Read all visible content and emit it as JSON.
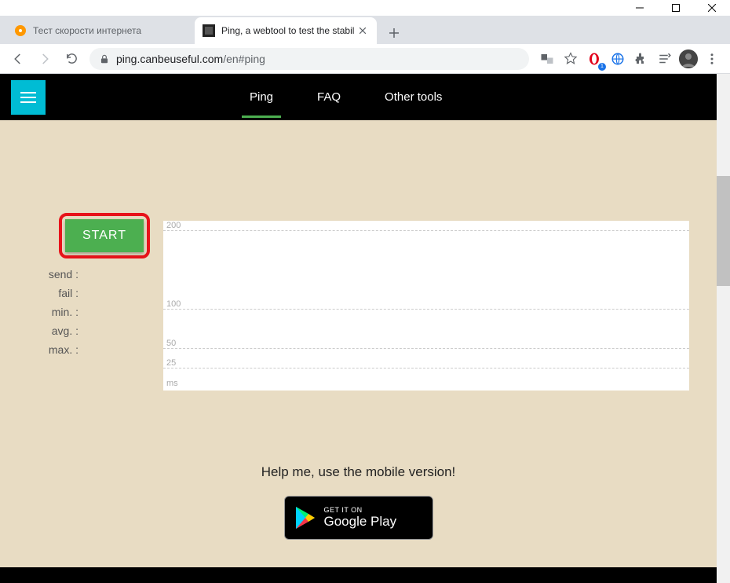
{
  "window": {
    "tabs": [
      {
        "title": "Тест скорости интернета",
        "active": false
      },
      {
        "title": "Ping, a webtool to test the stabil",
        "active": true
      }
    ]
  },
  "omnibox": {
    "host": "ping.canbeuseful.com",
    "path": "/en#ping"
  },
  "page": {
    "nav": {
      "items": [
        "Ping",
        "FAQ",
        "Other tools"
      ],
      "active_index": 0
    },
    "start_label": "START",
    "stats": {
      "send": "send :",
      "fail": "fail :",
      "min": "min. :",
      "avg": "avg. :",
      "max": "max. :"
    },
    "help_text": "Help me, use the mobile version!",
    "gplay": {
      "line1": "GET IT ON",
      "line2": "Google Play"
    }
  },
  "chart_data": {
    "type": "line",
    "title": "",
    "xlabel": "",
    "ylabel": "ms",
    "ylim": [
      0,
      200
    ],
    "yticks": [
      25,
      50,
      100,
      200
    ],
    "categories": [],
    "values": []
  }
}
